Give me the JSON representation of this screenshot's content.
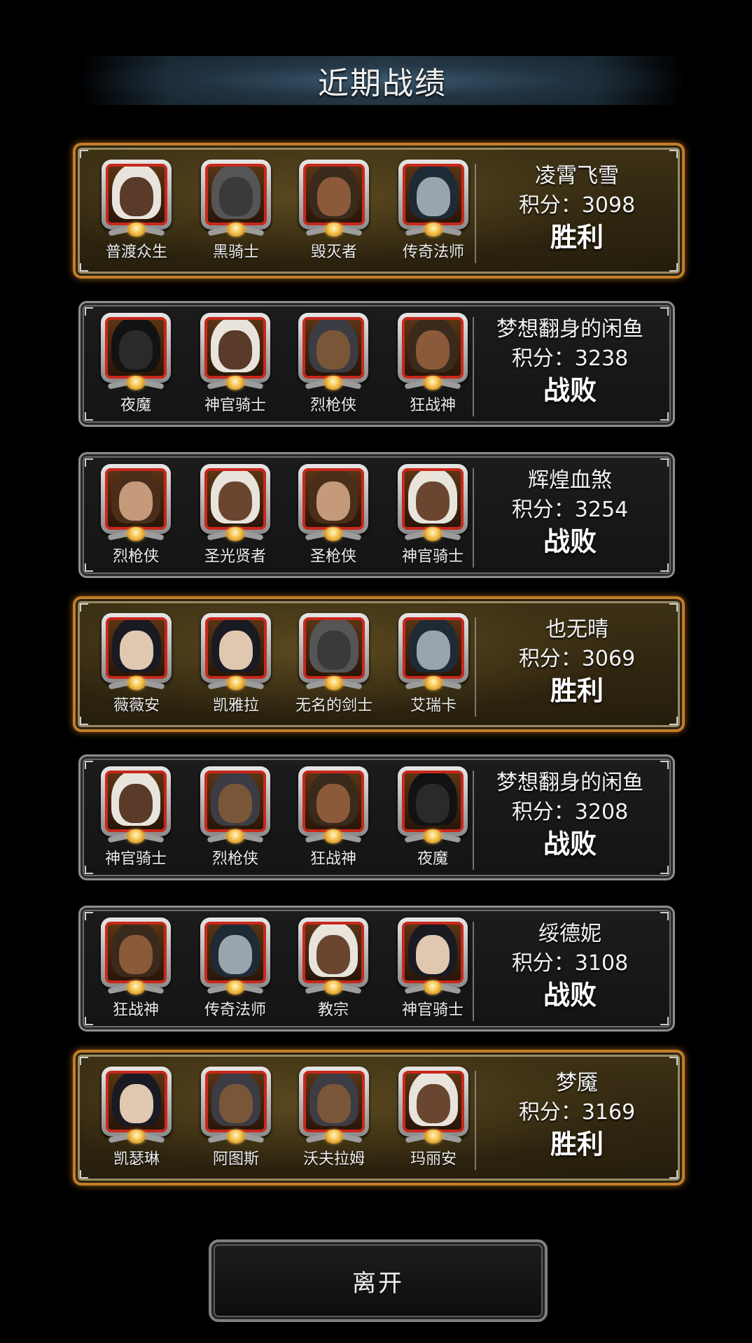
{
  "title": "近期战绩",
  "records": [
    {
      "player": "凌霄飞雪",
      "score_label": "积分：3098",
      "result": "胜利",
      "win": true,
      "heroes": [
        {
          "name": "普渡众生",
          "face": "#5a3a28",
          "hood": "#e8e4dc"
        },
        {
          "name": "黑骑士",
          "face": "#3a3a3a",
          "hood": "#555555"
        },
        {
          "name": "毁灭者",
          "face": "#8a5a3a",
          "hood": "#3a2a1c"
        },
        {
          "name": "传奇法师",
          "face": "#9aa4ac",
          "hood": "#1e2a36"
        }
      ]
    },
    {
      "player": "梦想翻身的闲鱼",
      "score_label": "积分：3238",
      "result": "战败",
      "win": false,
      "heroes": [
        {
          "name": "夜魔",
          "face": "#2a2a2a",
          "hood": "#121212"
        },
        {
          "name": "神官骑士",
          "face": "#5a3a28",
          "hood": "#e8e4dc"
        },
        {
          "name": "烈枪侠",
          "face": "#7a5638",
          "hood": "#3c3c44"
        },
        {
          "name": "狂战神",
          "face": "#8a5a3a",
          "hood": "#3a2a1c"
        }
      ]
    },
    {
      "player": "辉煌血煞",
      "score_label": "积分：3254",
      "result": "战败",
      "win": false,
      "heroes": [
        {
          "name": "烈枪侠",
          "face": "#c49a7a",
          "hood": "#4a2e1a"
        },
        {
          "name": "圣光贤者",
          "face": "#6a4630",
          "hood": "#e8e4dc"
        },
        {
          "name": "圣枪侠",
          "face": "#c49a7a",
          "hood": "#4a2e1a"
        },
        {
          "name": "神官骑士",
          "face": "#6a4630",
          "hood": "#e8e4dc"
        }
      ]
    },
    {
      "player": "也无晴",
      "score_label": "积分：3069",
      "result": "胜利",
      "win": true,
      "heroes": [
        {
          "name": "薇薇安",
          "face": "#e0c8b0",
          "hood": "#1a1a22"
        },
        {
          "name": "凯雅拉",
          "face": "#e0c8b0",
          "hood": "#1a1a22"
        },
        {
          "name": "无名的剑士",
          "face": "#3a3a3a",
          "hood": "#555555"
        },
        {
          "name": "艾瑞卡",
          "face": "#9aa4ac",
          "hood": "#1e2a36"
        }
      ]
    },
    {
      "player": "梦想翻身的闲鱼",
      "score_label": "积分：3208",
      "result": "战败",
      "win": false,
      "heroes": [
        {
          "name": "神官骑士",
          "face": "#5a3a28",
          "hood": "#e8e4dc"
        },
        {
          "name": "烈枪侠",
          "face": "#7a5638",
          "hood": "#3c3c44"
        },
        {
          "name": "狂战神",
          "face": "#8a5a3a",
          "hood": "#3a2a1c"
        },
        {
          "name": "夜魔",
          "face": "#2a2a2a",
          "hood": "#121212"
        }
      ]
    },
    {
      "player": "绥德妮",
      "score_label": "积分：3108",
      "result": "战败",
      "win": false,
      "heroes": [
        {
          "name": "狂战神",
          "face": "#8a5a3a",
          "hood": "#3a2a1c"
        },
        {
          "name": "传奇法师",
          "face": "#9aa4ac",
          "hood": "#1e2a36"
        },
        {
          "name": "教宗",
          "face": "#6a4630",
          "hood": "#e8e4dc"
        },
        {
          "name": "神官骑士",
          "face": "#e0c8b0",
          "hood": "#1a1a22"
        }
      ]
    },
    {
      "player": "梦魇",
      "score_label": "积分：3169",
      "result": "胜利",
      "win": true,
      "heroes": [
        {
          "name": "凯瑟琳",
          "face": "#e0c8b0",
          "hood": "#1a1a22"
        },
        {
          "name": "阿图斯",
          "face": "#7a5638",
          "hood": "#3c3c44"
        },
        {
          "name": "沃夫拉姆",
          "face": "#7a5638",
          "hood": "#3c3c44"
        },
        {
          "name": "玛丽安",
          "face": "#6a4630",
          "hood": "#e8e4dc"
        }
      ]
    }
  ],
  "leave_label": "离开"
}
